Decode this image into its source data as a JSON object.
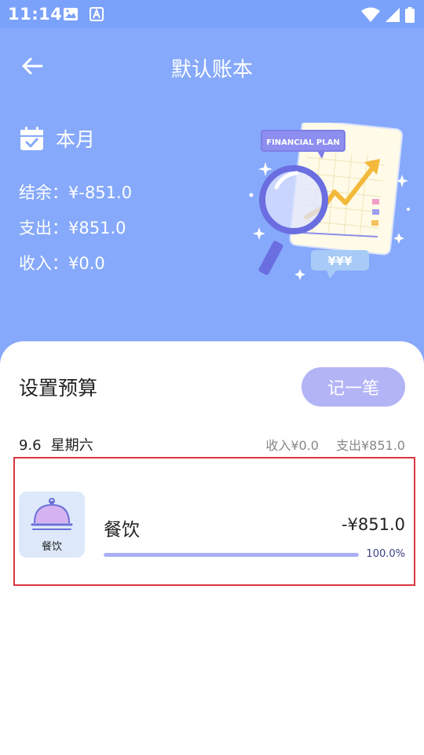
{
  "status": {
    "time": "11:14",
    "icons": [
      "image-icon",
      "text-a-icon",
      "wifi-icon",
      "signal-icon",
      "battery-icon"
    ]
  },
  "header": {
    "back_icon": "arrow-left-icon",
    "title": "默认账本"
  },
  "summary": {
    "period_label": "本月",
    "period_icon": "calendar-check-icon",
    "balance": "结余：¥-851.0",
    "expense": "支出：¥851.0",
    "income": "收入：¥0.0",
    "illustration": {
      "plan_label": "FINANCIAL PLAN",
      "currency_label": "¥¥¥"
    }
  },
  "budget": {
    "title": "设置预算",
    "record_button": "记一笔"
  },
  "day_group": {
    "date": "9.6",
    "weekday": "星期六",
    "income": "收入¥0.0",
    "expense": "支出¥851.0"
  },
  "category": {
    "icon": "food-cover-icon",
    "tile_label": "餐饮",
    "name": "餐饮",
    "amount": "-¥851.0",
    "percent_text": "100.0%",
    "progress": 1.0
  },
  "colors": {
    "header_bg": "#86a9fb",
    "accent_button": "#b3b4f6",
    "highlight_border": "#d9363e",
    "progress_fill": "#aab0f3"
  }
}
